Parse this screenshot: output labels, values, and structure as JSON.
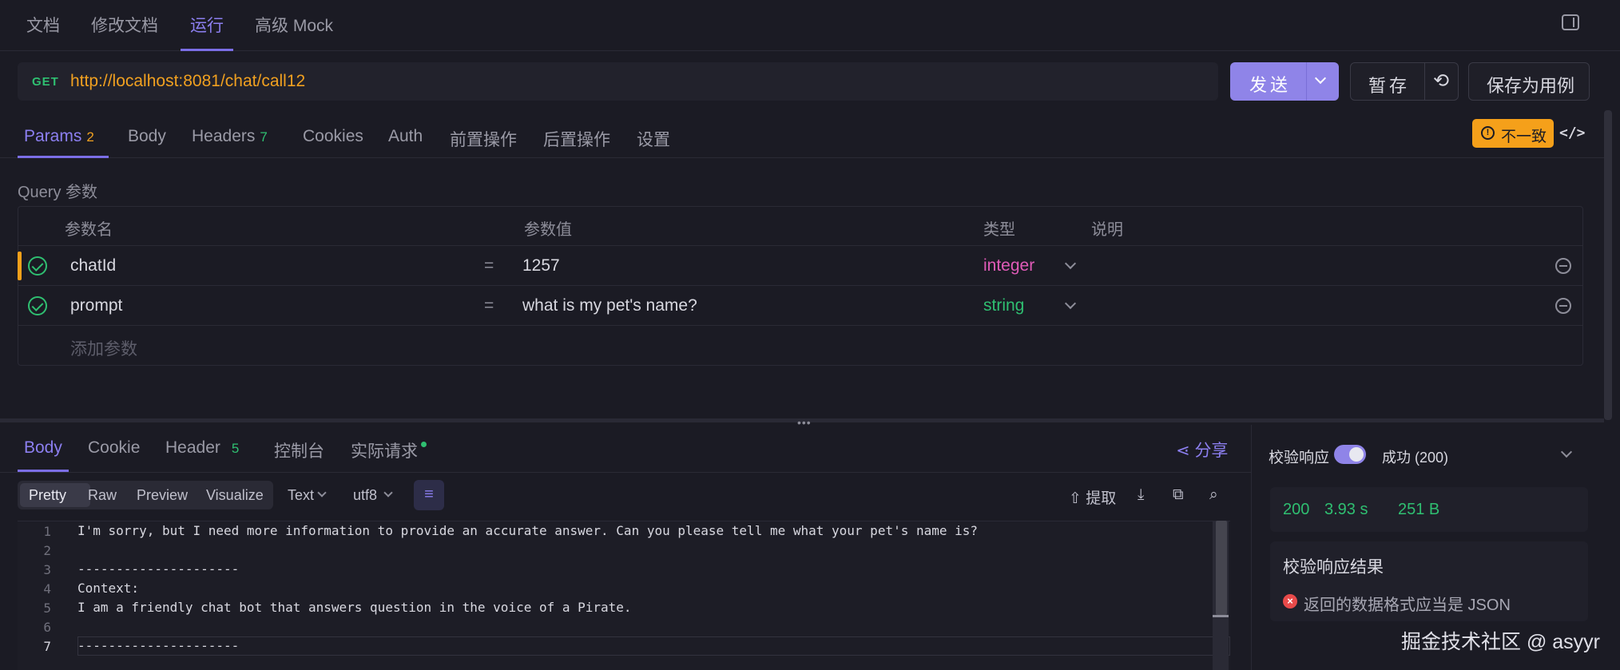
{
  "top_tabs": [
    {
      "label": "文档"
    },
    {
      "label": "修改文档"
    },
    {
      "label": "运行"
    },
    {
      "label": "高级 Mock"
    }
  ],
  "request": {
    "method": "GET",
    "url": "http://localhost:8081/chat/call12",
    "send_label": "发送",
    "save_temp_label": "暂存",
    "save_case_label": "保存为用例"
  },
  "request_tabs": [
    {
      "label": "Params",
      "badge": "2"
    },
    {
      "label": "Body"
    },
    {
      "label": "Headers",
      "badge": "7"
    },
    {
      "label": "Cookies"
    },
    {
      "label": "Auth"
    },
    {
      "label": "前置操作"
    },
    {
      "label": "后置操作"
    },
    {
      "label": "设置"
    }
  ],
  "mismatch_label": "不一致",
  "code_icon": "</>",
  "query_section_title": "Query 参数",
  "params_table": {
    "headers": [
      "参数名",
      "参数值",
      "类型",
      "说明"
    ],
    "rows": [
      {
        "name": "chatId",
        "eq": "=",
        "value": "1257",
        "type": "integer"
      },
      {
        "name": "prompt",
        "eq": "=",
        "value": "what is my pet's name?",
        "type": "string"
      }
    ],
    "add_placeholder": "添加参数"
  },
  "response_tabs": [
    {
      "label": "Body"
    },
    {
      "label": "Cookie"
    },
    {
      "label": "Header",
      "badge": "5"
    },
    {
      "label": "控制台"
    },
    {
      "label": "实际请求"
    }
  ],
  "share_label": "分享",
  "view_modes": [
    "Pretty",
    "Raw",
    "Preview",
    "Visualize"
  ],
  "format": {
    "type": "Text",
    "encoding": "utf8"
  },
  "tools": {
    "extract": "提取"
  },
  "code_lines": [
    "I'm sorry, but I need more information to provide an accurate answer. Can you please tell me what your pet's name is?",
    "",
    "---------------------",
    "Context:",
    "I am a friendly chat bot that answers question in the voice of a Pirate.",
    "",
    "---------------------"
  ],
  "line_numbers": [
    "1",
    "2",
    "3",
    "4",
    "5",
    "6",
    "7"
  ],
  "validation": {
    "label": "校验响应",
    "enabled": true,
    "status": "成功 (200)",
    "code": "200",
    "time": "3.93 s",
    "size": "251 B",
    "result_title": "校验响应结果",
    "error": "返回的数据格式应当是 JSON"
  },
  "watermark": "掘金技术社区 @ asyyr",
  "colors": {
    "accent": "#8f84e8",
    "warning": "#f5a01a",
    "success": "#2fbf71",
    "url": "#f0a020"
  }
}
